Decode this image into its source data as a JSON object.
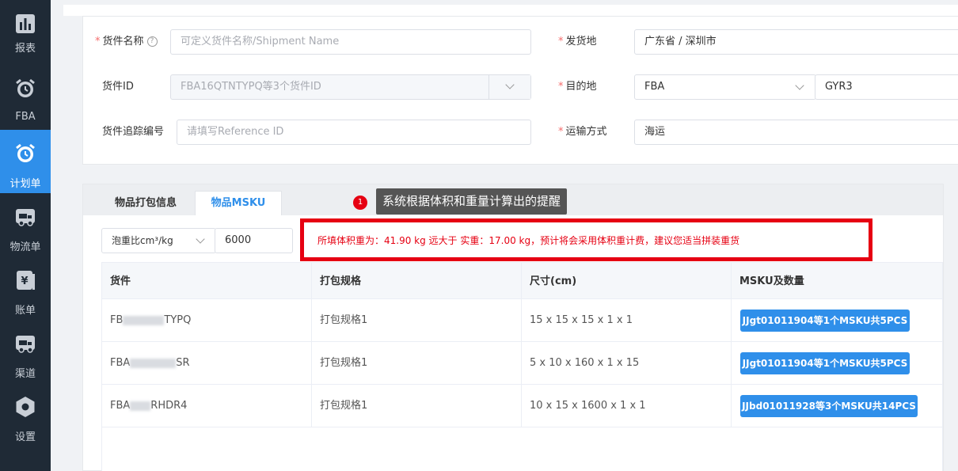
{
  "sidebar": {
    "items": [
      {
        "label": "报表",
        "icon": "chart-icon",
        "active": false
      },
      {
        "label": "FBA",
        "icon": "alarm-clock-icon",
        "active": false
      },
      {
        "label": "计划单",
        "icon": "alarm-clock-icon",
        "active": true
      },
      {
        "label": "物流单",
        "icon": "truck-icon",
        "active": false
      },
      {
        "label": "账单",
        "icon": "yuan-bill-icon",
        "active": false
      },
      {
        "label": "渠道",
        "icon": "truck-icon",
        "active": false
      },
      {
        "label": "设置",
        "icon": "hexagon-settings-icon",
        "active": false
      }
    ]
  },
  "form": {
    "shipment_name": {
      "label": "货件名称",
      "placeholder": "可定义货件名称/Shipment Name",
      "required": true
    },
    "shipment_id": {
      "label": "货件ID",
      "value": "FBA16QTNTYPQ等3个货件ID"
    },
    "reference_id": {
      "label": "货件追踪编号",
      "placeholder": "请填写Reference ID"
    },
    "ship_from": {
      "label": "发货地",
      "value": "广东省 / 深圳市",
      "required": true
    },
    "destination": {
      "label": "目的地",
      "type_value": "FBA",
      "code_value": "GYR3",
      "required": true
    },
    "transport": {
      "label": "运输方式",
      "value": "海运",
      "required": true
    }
  },
  "tabs": [
    {
      "label": "物品打包信息",
      "active": false
    },
    {
      "label": "物品MSKU",
      "active": true
    }
  ],
  "annotation": {
    "badge": "1",
    "text": "系统根据体积和重量计算出的提醒"
  },
  "volume_controls": {
    "unit_label": "泡重比cm³/kg",
    "divisor": "6000"
  },
  "alert": {
    "text": "所填体积重为：41.90 kg 远大于 实重：17.00 kg，预计将会采用体积重计费，建议您适当拼装重货"
  },
  "table": {
    "headers": [
      "货件",
      "打包规格",
      "尺寸(cm)",
      "MSKU及数量"
    ],
    "rows": [
      {
        "shipment_prefix": "FB",
        "shipment_suffix": "TYPQ",
        "spec": "打包规格1",
        "size": "15 x 15 x 15 x 1 x 1",
        "msku": "JJgt01011904等1个MSKU共5PCS"
      },
      {
        "shipment_prefix": "FBA",
        "shipment_suffix": "SR",
        "spec": "打包规格1",
        "size": "5 x 10 x 160 x 1 x 15",
        "msku": "JJgt01011904等1个MSKU共5PCS"
      },
      {
        "shipment_prefix": "FBA",
        "shipment_suffix": "RHDR4",
        "spec": "打包规格1",
        "size": "10 x 15 x 1600 x 1 x 1",
        "msku": "JJbd01011928等3个MSKU共14PCS"
      }
    ]
  },
  "colors": {
    "sidebar_bg": "#1f2a36",
    "accent": "#2f8fea",
    "alert_red": "#e60012"
  }
}
